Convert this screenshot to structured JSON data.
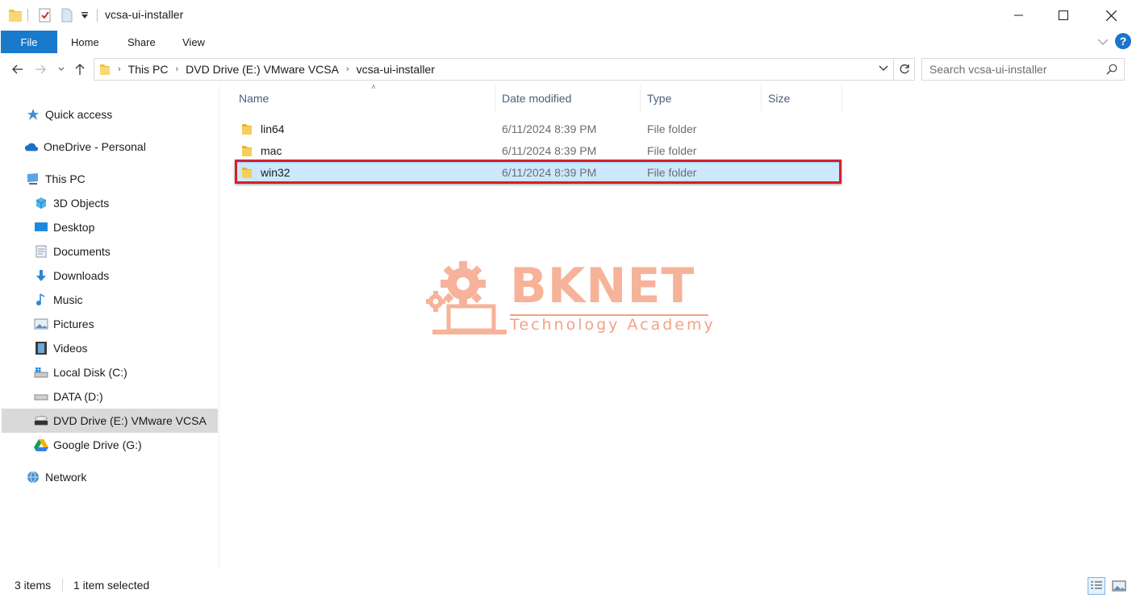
{
  "window": {
    "title": "vcsa-ui-installer"
  },
  "ribbon": {
    "tabs": [
      "File",
      "Home",
      "Share",
      "View"
    ],
    "help_label": "?"
  },
  "address": {
    "crumbs": [
      "This PC",
      "DVD Drive (E:) VMware VCSA",
      "vcsa-ui-installer"
    ],
    "search_placeholder": "Search vcsa-ui-installer"
  },
  "nav": {
    "quick_access": "Quick access",
    "onedrive": "OneDrive - Personal",
    "this_pc": "This PC",
    "items": [
      "3D Objects",
      "Desktop",
      "Documents",
      "Downloads",
      "Music",
      "Pictures",
      "Videos",
      "Local Disk (C:)",
      "DATA (D:)",
      "DVD Drive (E:) VMware VCSA",
      "Google Drive (G:)"
    ],
    "network": "Network",
    "selected": "DVD Drive (E:) VMware VCSA"
  },
  "columns": [
    "Name",
    "Date modified",
    "Type",
    "Size"
  ],
  "files": [
    {
      "name": "lin64",
      "date": "6/11/2024 8:39 PM",
      "type": "File folder",
      "size": ""
    },
    {
      "name": "mac",
      "date": "6/11/2024 8:39 PM",
      "type": "File folder",
      "size": ""
    },
    {
      "name": "win32",
      "date": "6/11/2024 8:39 PM",
      "type": "File folder",
      "size": "",
      "selected": true
    }
  ],
  "watermark": {
    "brand": "BKNET",
    "tagline": "Technology Academy"
  },
  "status": {
    "count": "3 items",
    "selection": "1 item selected"
  },
  "colors": {
    "accent": "#1979ca",
    "selection_bg": "#cce8ff",
    "highlight": "#d4202a",
    "folder": "#f3c13a"
  }
}
